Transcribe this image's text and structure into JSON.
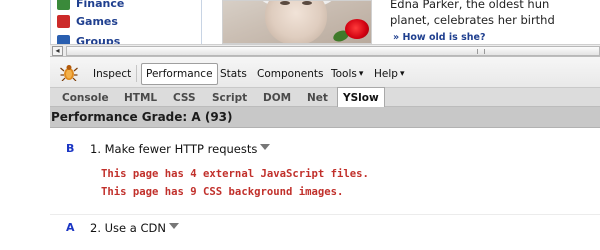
{
  "webpage": {
    "nav_items": [
      {
        "label": "Finance",
        "color": "#3a8a3a"
      },
      {
        "label": "Games",
        "color": "#cc2a2a"
      },
      {
        "label": "Groups",
        "color": "#2a5fb0"
      }
    ],
    "caption_line1": "Edna Parker, the oldest hun",
    "caption_line2": "planet, celebrates her birthd",
    "caption_link": "» How old is she?"
  },
  "firebug": {
    "toolbar": {
      "inspect": "Inspect",
      "performance": "Performance",
      "stats": "Stats",
      "components": "Components",
      "tools": "Tools",
      "help": "Help",
      "dropdown_glyph": "▾"
    },
    "tabs": [
      "Console",
      "HTML",
      "CSS",
      "Script",
      "DOM",
      "Net",
      "YSlow"
    ],
    "active_tab": "YSlow"
  },
  "yslow": {
    "grade_heading": "Performance Grade: A (93)",
    "rules": [
      {
        "grade": "B",
        "title": "1. Make fewer HTTP requests",
        "details": [
          "This page has 4 external JavaScript files.",
          "This page has 9 CSS background images."
        ]
      },
      {
        "grade": "A",
        "title": "2. Use a CDN",
        "details": []
      }
    ]
  },
  "colors": {
    "grade_letter": "#1b36c4",
    "detail_text": "#c1302b",
    "grade_bar": "#c8c8c8"
  }
}
